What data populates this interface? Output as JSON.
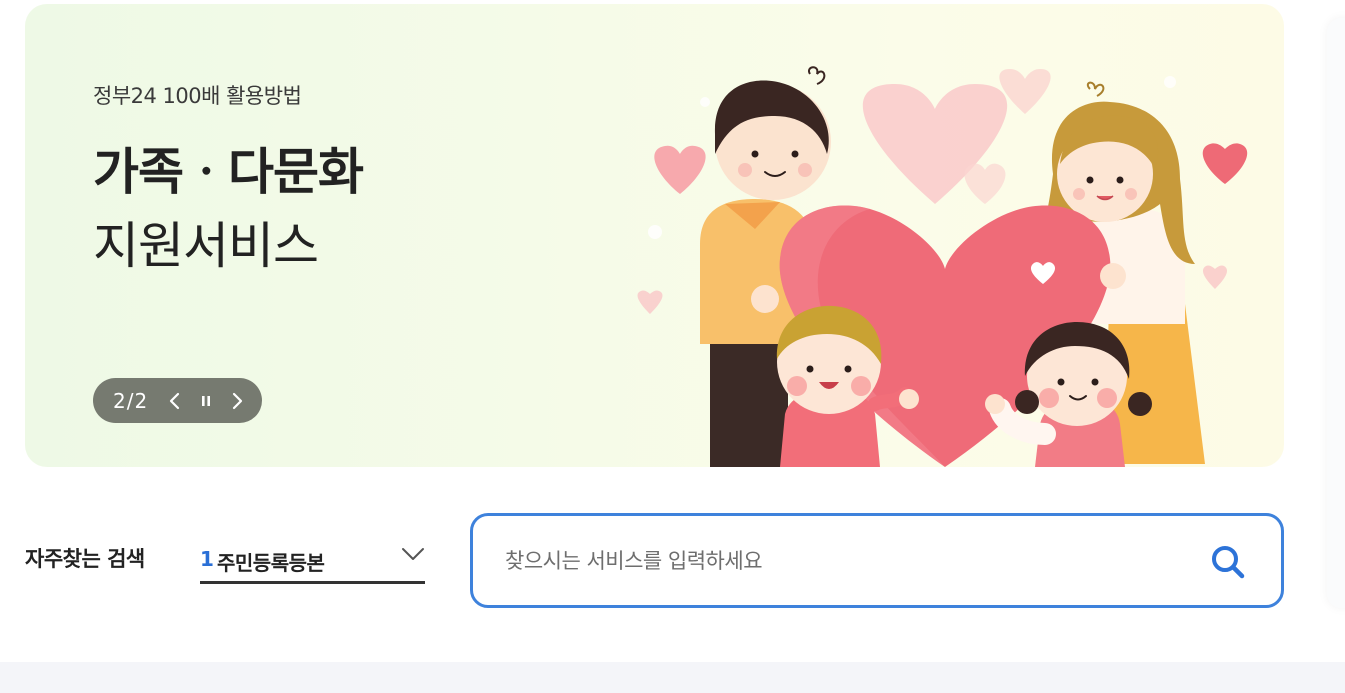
{
  "banner": {
    "kicker": "정부24 100배 활용방법",
    "title": "가족ㆍ다문화",
    "subtitle": "지원서비스",
    "pager": {
      "current_total": "2/2",
      "prev_icon": "chevron-left-icon",
      "pause_icon": "pause-icon",
      "next_icon": "chevron-right-icon"
    },
    "illustration": "family-with-heart-illustration"
  },
  "frequent_search": {
    "label": "자주찾는 검색",
    "rank": "1",
    "selected": "주민등록등본",
    "dropdown_icon": "chevron-down-icon"
  },
  "search": {
    "placeholder": "찾으시는 서비스를 입력하세요",
    "value": "",
    "button_icon": "search-icon"
  },
  "colors": {
    "accent": "#3e82dc",
    "rank": "#2a6fd6",
    "pager_bg": "#767a70",
    "heart": "#ef6b78"
  }
}
